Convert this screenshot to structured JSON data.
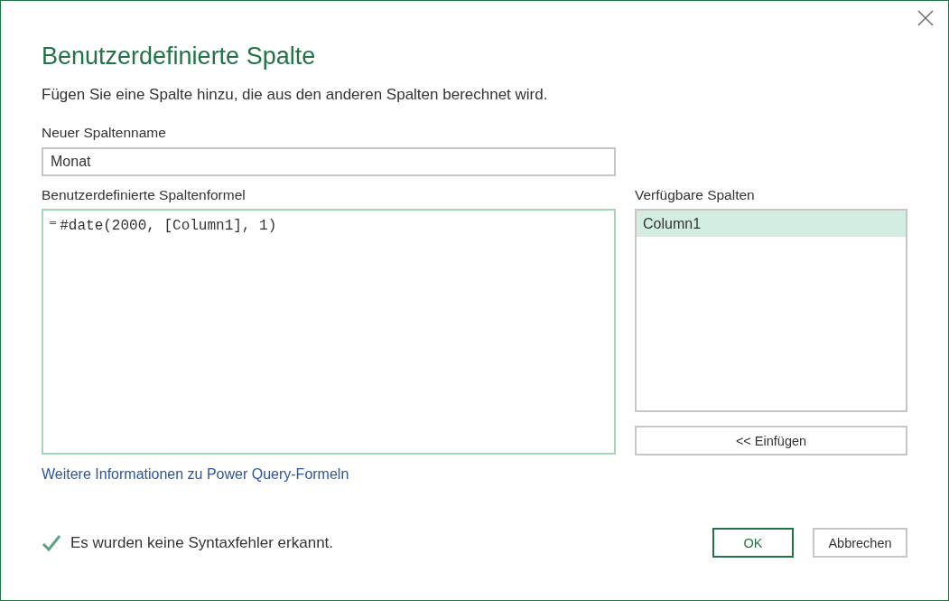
{
  "window": {
    "title": "Benutzerdefinierte Spalte",
    "subtitle": "Fügen Sie eine Spalte hinzu, die aus den anderen Spalten berechnet wird."
  },
  "name_field": {
    "label": "Neuer Spaltenname",
    "value": "Monat"
  },
  "formula": {
    "label": "Benutzerdefinierte Spaltenformel",
    "prefix": "=",
    "value": "#date(2000, [Column1], 1)"
  },
  "available_columns": {
    "label": "Verfügbare Spalten",
    "items": [
      {
        "label": "Column1",
        "selected": true
      }
    ],
    "insert_button": "<< Einfügen"
  },
  "help_link": "Weitere Informationen zu Power Query-Formeln",
  "status": {
    "kind": "valid",
    "text": "Es wurden keine Syntaxfehler erkannt."
  },
  "buttons": [
    {
      "label": "OK",
      "default": true
    },
    {
      "label": "Abbrechen",
      "default": false
    }
  ]
}
